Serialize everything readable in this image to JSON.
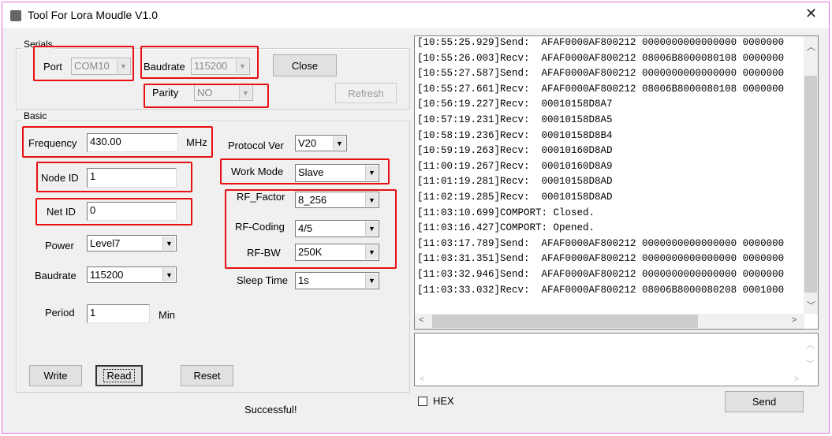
{
  "window": {
    "title": "Tool For Lora Moudle V1.0",
    "close": "✕"
  },
  "serials": {
    "group": "Serials",
    "port_label": "Port",
    "port_value": "COM10",
    "baud_label": "Baudrate",
    "baud_value": "115200",
    "parity_label": "Parity",
    "parity_value": "NO",
    "close_button": "Close",
    "refresh_button": "Refresh"
  },
  "basic": {
    "group": "Basic",
    "frequency_label": "Frequency",
    "frequency_value": "430.00",
    "frequency_unit": "MHz",
    "protocol_label": "Protocol Ver",
    "protocol_value": "V20",
    "node_label": "Node ID",
    "node_value": "1",
    "workmode_label": "Work Mode",
    "workmode_value": "Slave",
    "net_label": "Net ID",
    "net_value": "0",
    "rffactor_label": "RF_Factor",
    "rffactor_value": "8_256",
    "rfcoding_label": "RF-Coding",
    "rfcoding_value": "4/5",
    "rfbw_label": "RF-BW",
    "rfbw_value": "250K",
    "power_label": "Power",
    "power_value": "Level7",
    "sleep_label": "Sleep Time",
    "sleep_value": "1s",
    "baud_label": "Baudrate",
    "baud_value": "115200",
    "period_label": "Period",
    "period_value": "1",
    "period_unit": "Min"
  },
  "actions": {
    "write": "Write",
    "read": "Read",
    "reset": "Reset",
    "status": "Successful!"
  },
  "log": [
    "[10:55:25.929]Send:  AFAF0000AF800212 0000000000000000 0000000",
    "[10:55:26.003]Recv:  AFAF0000AF800212 08006B8000080108 0000000",
    "[10:55:27.587]Send:  AFAF0000AF800212 0000000000000000 0000000",
    "[10:55:27.661]Recv:  AFAF0000AF800212 08006B8000080108 0000000",
    "[10:56:19.227]Recv:  00010158D8A7",
    "[10:57:19.231]Recv:  00010158D8A5",
    "[10:58:19.236]Recv:  00010158D8B4",
    "[10:59:19.263]Recv:  00010160D8AD",
    "[11:00:19.267]Recv:  00010160D8A9",
    "[11:01:19.281]Recv:  00010158D8AD",
    "[11:02:19.285]Recv:  00010158D8AD",
    "[11:03:10.699]COMPORT: Closed.",
    "[11:03:16.427]COMPORT: Opened.",
    "[11:03:17.789]Send:  AFAF0000AF800212 0000000000000000 0000000",
    "[11:03:31.351]Send:  AFAF0000AF800212 0000000000000000 0000000",
    "[11:03:32.946]Send:  AFAF0000AF800212 0000000000000000 0000000",
    "[11:03:33.032]Recv:  AFAF0000AF800212 08006B8000080208 0001000"
  ],
  "send": {
    "hex_label": "HEX",
    "send_button": "Send"
  },
  "colors": {
    "annotation": "#e81010"
  }
}
